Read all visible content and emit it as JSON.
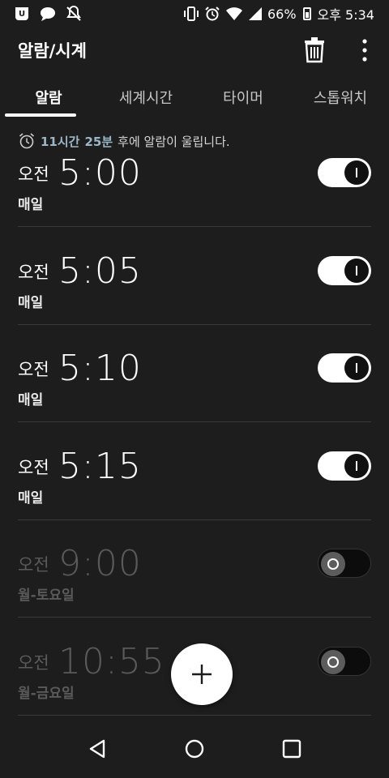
{
  "status_bar": {
    "battery_percent": "66%",
    "time": "오후 5:34",
    "icons": [
      "u-app-icon",
      "chat-bubble-icon",
      "bell-off-icon",
      "vibrate-icon",
      "alarm-clock-icon",
      "wifi-icon",
      "signal-icon",
      "battery-icon"
    ]
  },
  "app_bar": {
    "title": "알람/시계",
    "icons": [
      "trash-icon",
      "more-vert-icon"
    ]
  },
  "tabs": [
    {
      "label": "알람",
      "active": true
    },
    {
      "label": "세계시간",
      "active": false
    },
    {
      "label": "타이머",
      "active": false
    },
    {
      "label": "스톱워치",
      "active": false
    }
  ],
  "next_alarm": {
    "hours": "11시간",
    "minutes": "25분",
    "suffix": "후에 알람이 울립니다."
  },
  "alarms": [
    {
      "ampm": "오전",
      "time": "5:00",
      "repeat": "매일",
      "enabled": true
    },
    {
      "ampm": "오전",
      "time": "5:05",
      "repeat": "매일",
      "enabled": true
    },
    {
      "ampm": "오전",
      "time": "5:10",
      "repeat": "매일",
      "enabled": true
    },
    {
      "ampm": "오전",
      "time": "5:15",
      "repeat": "매일",
      "enabled": true
    },
    {
      "ampm": "오전",
      "time": "9:00",
      "repeat": "월-토요일",
      "enabled": false
    },
    {
      "ampm": "오전",
      "time": "10:55",
      "repeat": "월-금요일",
      "enabled": false
    }
  ],
  "fab": {
    "icon": "plus-icon"
  },
  "nav_bar": {
    "icons": [
      "back-icon",
      "home-icon",
      "recents-icon"
    ]
  },
  "colors": {
    "background": "#1d1d1d",
    "accent_text": "#9bb6c6",
    "disabled_text": "#5a5a5a",
    "divider": "#3a3a3a"
  }
}
